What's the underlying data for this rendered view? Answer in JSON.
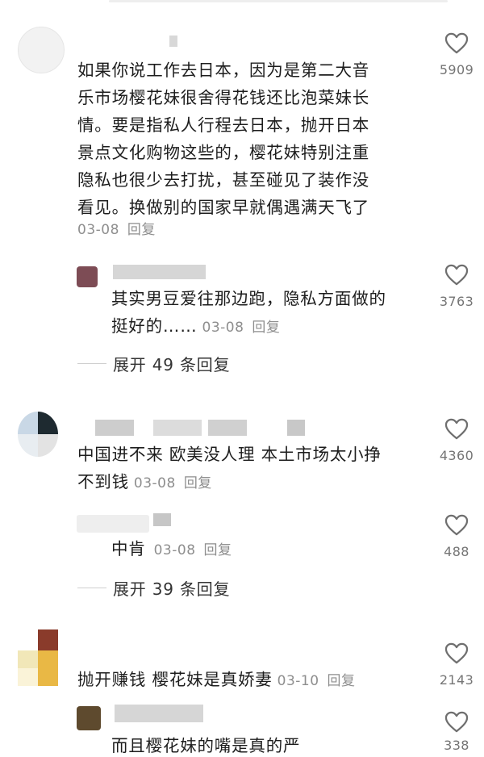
{
  "comments": [
    {
      "text_lines": [
        "如果你说工作去日本，因为是第二大音",
        "乐市场樱花妹很舍得花钱还比泡菜妹长",
        "情。要是指私人行程去日本，抛开日本",
        "景点文化购物这些的，樱花妹特别注重",
        "隐私也很少去打扰，甚至碰见了装作没",
        "看见。换做别的国家早就偶遇满天飞了"
      ],
      "date": "03-08",
      "reply_label": "回复",
      "likes": "5909",
      "replies": [
        {
          "text_first": "其实男豆爱往那边跑，隐私方面做的",
          "text_last": "挺好的……",
          "date": "03-08",
          "reply_label": "回复",
          "likes": "3763"
        }
      ],
      "expand_label": "展开 49 条回复"
    },
    {
      "text_first": "中国进不来 欧美没人理 本土市场太小挣",
      "text_last": "不到钱",
      "date": "03-08",
      "reply_label": "回复",
      "likes": "4360",
      "replies": [
        {
          "text_last": "中肯",
          "date": "03-08",
          "reply_label": "回复",
          "likes": "488"
        }
      ],
      "expand_label": "展开 39 条回复"
    },
    {
      "text_last": "抛开赚钱 樱花妹是真娇妻",
      "date": "03-10",
      "reply_label": "回复",
      "likes": "2143",
      "replies": [
        {
          "text_last": "而且樱花妹的嘴是真的严",
          "likes": "338"
        }
      ]
    }
  ],
  "icons": {
    "like": "heart-outline-icon"
  },
  "colors": {
    "text": "#1d1d1d",
    "meta": "#8e8e8e",
    "count": "#757575",
    "heart": "#6f6f6f"
  }
}
